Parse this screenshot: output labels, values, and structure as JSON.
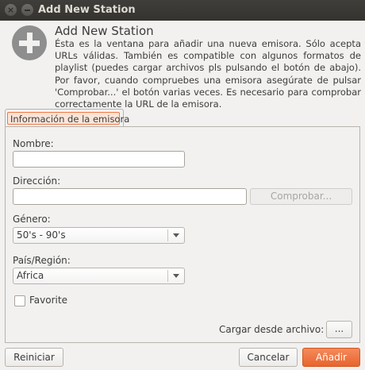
{
  "window": {
    "title": "Add New Station"
  },
  "titlebar": {
    "close_glyph": "×"
  },
  "header": {
    "icon": "add-circle-icon",
    "title": "Add New Station",
    "description": "Ésta es la ventana para añadir una nueva emisora. Sólo acepta URLs válidas. También es compatible con algunos formatos de playlist (puedes cargar archivos pls pulsando el botón de abajo). Por favor, cuando compruebes una emisora asegúrate de pulsar 'Comprobar...' el botón varias veces. Es necesario para comprobar correctamente la URL de la emisora."
  },
  "tab": {
    "label": "Información de la emisora",
    "accent": "#f07746"
  },
  "form": {
    "name_label": "Nombre:",
    "name_value": "",
    "address_label": "Dirección:",
    "address_value": "",
    "check_button": "Comprobar...",
    "genre_label": "Género:",
    "genre_value": "50's - 90's",
    "country_label": "País/Región:",
    "country_value": "Africa",
    "favorite_label": "Favorite",
    "favorite_checked": false,
    "load_file_label": "Cargar desde archivo:",
    "load_file_button": "..."
  },
  "footer": {
    "reset_button": "Reiniciar",
    "cancel_button": "Cancelar",
    "add_button": "Añadir",
    "add_color": "#e8652d"
  }
}
